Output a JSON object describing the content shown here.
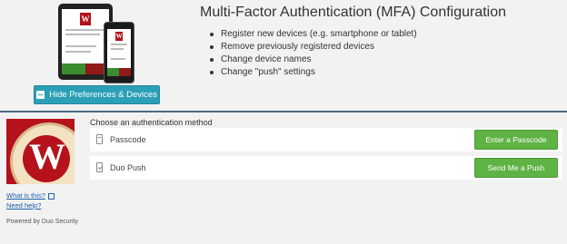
{
  "header": {
    "title": "Multi-Factor Authentication (MFA) Configuration",
    "features": [
      "Register new devices (e.g. smartphone or tablet)",
      "Remove previously registered devices",
      "Change device names",
      "Change \"push\" settings"
    ],
    "toggle_button_label": "Hide Preferences & Devices"
  },
  "auth": {
    "prompt": "Choose an authentication method",
    "methods": [
      {
        "label": "Passcode",
        "icon": "passcode-icon",
        "action_label": "Enter a Passcode"
      },
      {
        "label": "Duo Push",
        "icon": "push-phone-icon",
        "action_label": "Send Me a Push"
      }
    ]
  },
  "sidebar": {
    "brand_letter": "W",
    "whats_this": "What is this?",
    "need_help": "Need help?",
    "powered_by": "Powered by Duo Security"
  },
  "colors": {
    "accent_teal": "#2b9fb8",
    "action_green": "#5fb244",
    "brand_red": "#b5121b",
    "link_blue": "#1f5fa8"
  }
}
